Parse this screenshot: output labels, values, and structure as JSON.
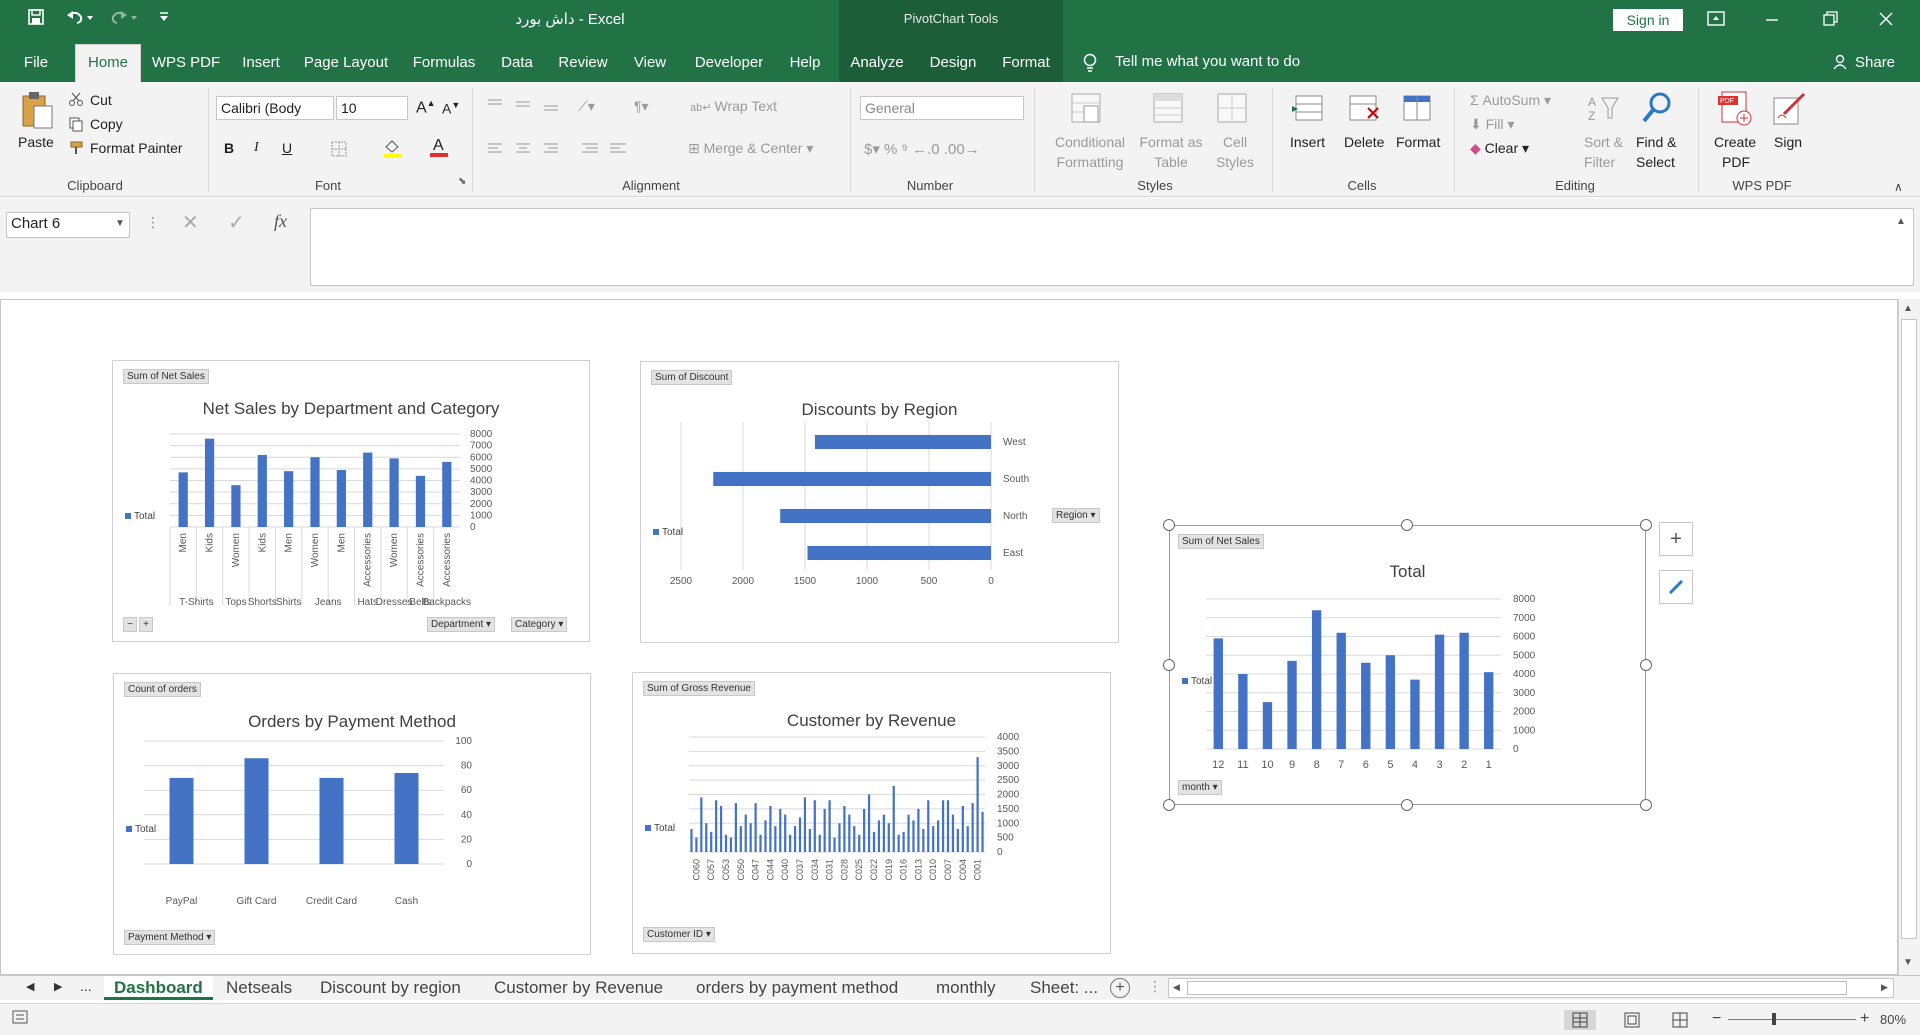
{
  "titlebar": {
    "doc_title": "داش بورد  -  Excel",
    "context_title": "PivotChart Tools",
    "sign_in": "Sign in",
    "qat": {
      "save_icon": "save-icon",
      "undo_icon": "undo-icon",
      "redo_icon": "redo-icon",
      "customize_icon": "chevron-down-icon"
    }
  },
  "tabs": [
    {
      "label": "File"
    },
    {
      "label": "Home"
    },
    {
      "label": "WPS PDF"
    },
    {
      "label": "Insert"
    },
    {
      "label": "Page Layout"
    },
    {
      "label": "Formulas"
    },
    {
      "label": "Data"
    },
    {
      "label": "Review"
    },
    {
      "label": "View"
    },
    {
      "label": "Developer"
    },
    {
      "label": "Help"
    },
    {
      "label": "Analyze"
    },
    {
      "label": "Design"
    },
    {
      "label": "Format"
    }
  ],
  "tell_me": "Tell me what you want to do",
  "share": "Share",
  "ribbon": {
    "clipboard": {
      "label": "Clipboard",
      "paste": "Paste",
      "cut": "Cut",
      "copy": "Copy",
      "format_painter": "Format Painter"
    },
    "font": {
      "label": "Font",
      "name": "Calibri (Body",
      "size": "10",
      "bold": "B",
      "italic": "I",
      "underline": "U"
    },
    "alignment": {
      "label": "Alignment",
      "wrap": "Wrap Text",
      "merge": "Merge & Center"
    },
    "number": {
      "label": "Number",
      "format": "General"
    },
    "styles": {
      "label": "Styles",
      "cond1": "Conditional",
      "cond2": "Formatting",
      "fat1": "Format as",
      "fat2": "Table",
      "cs1": "Cell",
      "cs2": "Styles"
    },
    "cells": {
      "label": "Cells",
      "insert": "Insert",
      "delete": "Delete",
      "format": "Format"
    },
    "editing": {
      "label": "Editing",
      "autosum": "AutoSum",
      "fill": "Fill",
      "clear": "Clear",
      "sort1": "Sort &",
      "sort2": "Filter",
      "find1": "Find &",
      "find2": "Select"
    },
    "wpspdf": {
      "label": "WPS PDF",
      "create1": "Create",
      "create2": "PDF",
      "sign": "Sign"
    }
  },
  "formula_bar": {
    "name_box": "Chart 6",
    "fx": "fx",
    "value": ""
  },
  "charts": {
    "c1": {
      "field": "Sum of Net Sales",
      "title": "Net Sales by Department and Category",
      "legend": "Total",
      "btn_dept": "Department",
      "btn_cat": "Category"
    },
    "c2": {
      "field": "Sum of Discount",
      "title": "Discounts by Region",
      "legend": "Total",
      "btn_region": "Region"
    },
    "c3": {
      "field": "Count of orders",
      "title": "Orders by Payment Method",
      "legend": "Total",
      "btn_pm": "Payment Method"
    },
    "c4": {
      "field": "Sum of Gross Revenue",
      "title": "Customer by Revenue",
      "legend": "Total",
      "btn_cust": "Customer ID"
    },
    "c5": {
      "field": "Sum of Net Sales",
      "title": "Total",
      "legend": "Total",
      "btn_month": "month"
    }
  },
  "chart_data": [
    {
      "type": "bar",
      "title": "Net Sales by Department and Category",
      "categories": [
        "Men",
        "Kids",
        "Women",
        "Kids",
        "Men",
        "Women",
        "Men",
        "Accessories",
        "Women",
        "Accessories",
        "Accessories"
      ],
      "groups": [
        "T-Shirts",
        "Tops",
        "Shorts",
        "Shirts",
        "Jeans",
        "Hats",
        "Dresses",
        "Belts",
        "Backpacks"
      ],
      "values": [
        4700,
        7600,
        3600,
        6200,
        4800,
        6000,
        4900,
        6400,
        5900,
        4400,
        5600
      ],
      "ylim": [
        0,
        8000
      ],
      "yticks": [
        "8000",
        "7000",
        "6000",
        "5000",
        "4000",
        "3000",
        "2000",
        "1000",
        "0"
      ],
      "series": [
        {
          "name": "Total"
        }
      ]
    },
    {
      "type": "bar",
      "title": "Discounts by Region",
      "orientation": "horizontal",
      "categories": [
        "West",
        "South",
        "North",
        "East"
      ],
      "values": [
        1420,
        2240,
        1700,
        1480
      ],
      "xticks": [
        "2500",
        "2000",
        "1500",
        "1000",
        "500",
        "0"
      ],
      "series": [
        {
          "name": "Total"
        }
      ]
    },
    {
      "type": "bar",
      "title": "Orders by Payment Method",
      "categories": [
        "PayPal",
        "Gift Card",
        "Credit Card",
        "Cash"
      ],
      "values": [
        70,
        86,
        70,
        74
      ],
      "ylim": [
        0,
        100
      ],
      "yticks": [
        "100",
        "80",
        "60",
        "40",
        "20",
        "0"
      ],
      "series": [
        {
          "name": "Total"
        }
      ]
    },
    {
      "type": "bar",
      "title": "Customer by Revenue",
      "x_labels": [
        "C060",
        "C057",
        "C053",
        "C050",
        "C047",
        "C044",
        "C040",
        "C037",
        "C034",
        "C031",
        "C028",
        "C025",
        "C022",
        "C019",
        "C016",
        "C013",
        "C010",
        "C007",
        "C004",
        "C001"
      ],
      "values": [
        800,
        500,
        1900,
        1000,
        700,
        1800,
        1600,
        600,
        500,
        1700,
        900,
        1300,
        1000,
        1700,
        600,
        1100,
        1600,
        900,
        1500,
        1300,
        600,
        900,
        1200,
        1900,
        800,
        1800,
        600,
        1500,
        1800,
        500,
        1000,
        1600,
        1300,
        900,
        600,
        1500,
        2000,
        700,
        1100,
        1300,
        1000,
        2300,
        600,
        700,
        1300,
        1100,
        1500,
        800,
        1800,
        900,
        1100,
        1800,
        1800,
        1300,
        800,
        1600,
        900,
        1700,
        3300,
        1400
      ],
      "ylim": [
        0,
        4000
      ],
      "yticks": [
        "4000",
        "3500",
        "3000",
        "2500",
        "2000",
        "1500",
        "1000",
        "500",
        "0"
      ],
      "series": [
        {
          "name": "Total"
        }
      ]
    },
    {
      "type": "bar",
      "title": "Total",
      "categories": [
        "12",
        "11",
        "10",
        "9",
        "8",
        "7",
        "6",
        "5",
        "4",
        "3",
        "2",
        "1"
      ],
      "values": [
        5900,
        4000,
        2500,
        4700,
        7400,
        6200,
        4600,
        5000,
        3700,
        6100,
        6200,
        4100
      ],
      "ylim": [
        0,
        8000
      ],
      "yticks": [
        "8000",
        "7000",
        "6000",
        "5000",
        "4000",
        "3000",
        "2000",
        "1000",
        "0"
      ],
      "series": [
        {
          "name": "Total"
        }
      ]
    }
  ],
  "sheet_tabs": [
    {
      "label": "Dashboard",
      "active": true
    },
    {
      "label": "Netseals"
    },
    {
      "label": "Discount by region"
    },
    {
      "label": "Customer by Revenue"
    },
    {
      "label": "orders by payment method"
    },
    {
      "label": "monthly"
    },
    {
      "label": "Sheet: ..."
    }
  ],
  "tab_nav": {
    "ellipsis": "..."
  },
  "status": {
    "zoom": "80%"
  },
  "colors": {
    "excel_green": "#217346",
    "bar_blue": "#4472c4"
  }
}
